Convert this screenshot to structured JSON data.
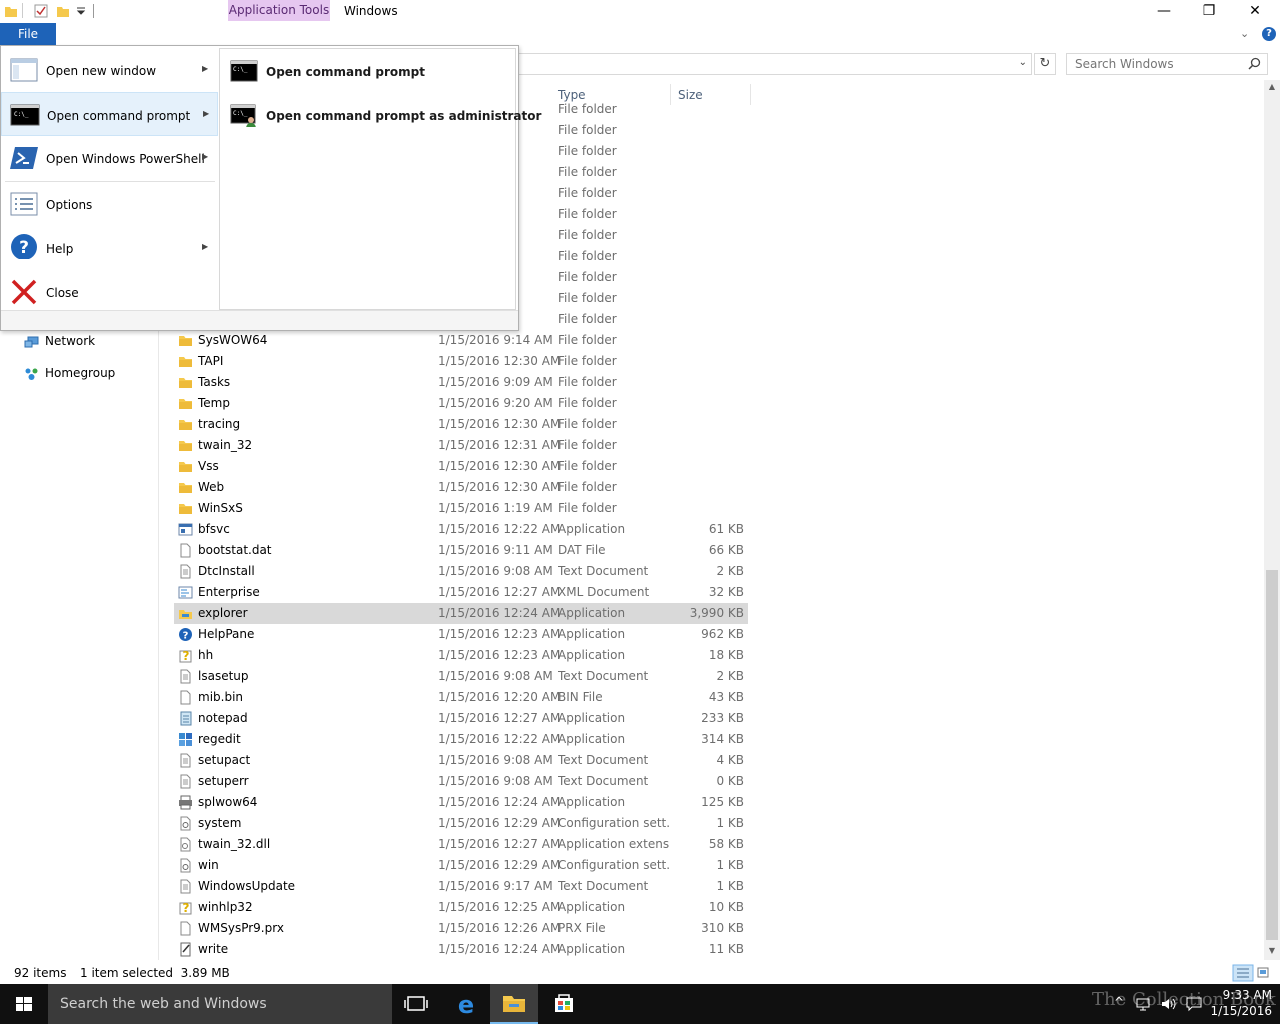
{
  "window": {
    "context_tab": "Application Tools",
    "title": "Windows",
    "min_glyph": "—",
    "max_glyph": "❐",
    "close_glyph": "✕"
  },
  "ribbon": {
    "file_tab": "File",
    "expand_glyph": "⌄",
    "help_glyph": "?"
  },
  "address": {
    "dropdown_glyph": "⌄",
    "refresh_glyph": "↻"
  },
  "search": {
    "placeholder": "Search Windows"
  },
  "nav": {
    "items": [
      {
        "label": "Network",
        "icon": "network-icon"
      },
      {
        "label": "Homegroup",
        "icon": "homegroup-icon"
      }
    ]
  },
  "columns": {
    "type": "Type",
    "size": "Size"
  },
  "files": [
    {
      "name": "",
      "date": "",
      "type": "File folder",
      "size": "",
      "icon": "folder"
    },
    {
      "name": "",
      "date": "AM",
      "type": "File folder",
      "size": "",
      "icon": "folder"
    },
    {
      "name": "",
      "date": "AM",
      "type": "File folder",
      "size": "",
      "icon": "folder"
    },
    {
      "name": "",
      "date": "AM",
      "type": "File folder",
      "size": "",
      "icon": "folder"
    },
    {
      "name": "",
      "date": "AM",
      "type": "File folder",
      "size": "",
      "icon": "folder"
    },
    {
      "name": "",
      "date": "AM",
      "type": "File folder",
      "size": "",
      "icon": "folder"
    },
    {
      "name": "",
      "date": "AM",
      "type": "File folder",
      "size": "",
      "icon": "folder"
    },
    {
      "name": "",
      "date": "AM",
      "type": "File folder",
      "size": "",
      "icon": "folder"
    },
    {
      "name": "",
      "date": "AM",
      "type": "File folder",
      "size": "",
      "icon": "folder"
    },
    {
      "name": "",
      "date": "AM",
      "type": "File folder",
      "size": "",
      "icon": "folder"
    },
    {
      "name": "",
      "date": "AM",
      "type": "File folder",
      "size": "",
      "icon": "folder"
    },
    {
      "name": "SysWOW64",
      "date": "1/15/2016 9:14 AM",
      "type": "File folder",
      "size": "",
      "icon": "folder"
    },
    {
      "name": "TAPI",
      "date": "1/15/2016 12:30 AM",
      "type": "File folder",
      "size": "",
      "icon": "folder"
    },
    {
      "name": "Tasks",
      "date": "1/15/2016 9:09 AM",
      "type": "File folder",
      "size": "",
      "icon": "folder"
    },
    {
      "name": "Temp",
      "date": "1/15/2016 9:20 AM",
      "type": "File folder",
      "size": "",
      "icon": "folder"
    },
    {
      "name": "tracing",
      "date": "1/15/2016 12:30 AM",
      "type": "File folder",
      "size": "",
      "icon": "folder"
    },
    {
      "name": "twain_32",
      "date": "1/15/2016 12:31 AM",
      "type": "File folder",
      "size": "",
      "icon": "folder"
    },
    {
      "name": "Vss",
      "date": "1/15/2016 12:30 AM",
      "type": "File folder",
      "size": "",
      "icon": "folder"
    },
    {
      "name": "Web",
      "date": "1/15/2016 12:30 AM",
      "type": "File folder",
      "size": "",
      "icon": "folder"
    },
    {
      "name": "WinSxS",
      "date": "1/15/2016 1:19 AM",
      "type": "File folder",
      "size": "",
      "icon": "folder"
    },
    {
      "name": "bfsvc",
      "date": "1/15/2016 12:22 AM",
      "type": "Application",
      "size": "61 KB",
      "icon": "app"
    },
    {
      "name": "bootstat.dat",
      "date": "1/15/2016 9:11 AM",
      "type": "DAT File",
      "size": "66 KB",
      "icon": "file"
    },
    {
      "name": "DtcInstall",
      "date": "1/15/2016 9:08 AM",
      "type": "Text Document",
      "size": "2 KB",
      "icon": "text"
    },
    {
      "name": "Enterprise",
      "date": "1/15/2016 12:27 AM",
      "type": "XML Document",
      "size": "32 KB",
      "icon": "xml"
    },
    {
      "name": "explorer",
      "date": "1/15/2016 12:24 AM",
      "type": "Application",
      "size": "3,990 KB",
      "icon": "explorer",
      "selected": true
    },
    {
      "name": "HelpPane",
      "date": "1/15/2016 12:23 AM",
      "type": "Application",
      "size": "962 KB",
      "icon": "help"
    },
    {
      "name": "hh",
      "date": "1/15/2016 12:23 AM",
      "type": "Application",
      "size": "18 KB",
      "icon": "hh"
    },
    {
      "name": "lsasetup",
      "date": "1/15/2016 9:08 AM",
      "type": "Text Document",
      "size": "2 KB",
      "icon": "text"
    },
    {
      "name": "mib.bin",
      "date": "1/15/2016 12:20 AM",
      "type": "BIN File",
      "size": "43 KB",
      "icon": "file"
    },
    {
      "name": "notepad",
      "date": "1/15/2016 12:27 AM",
      "type": "Application",
      "size": "233 KB",
      "icon": "notepad"
    },
    {
      "name": "regedit",
      "date": "1/15/2016 12:22 AM",
      "type": "Application",
      "size": "314 KB",
      "icon": "regedit"
    },
    {
      "name": "setupact",
      "date": "1/15/2016 9:08 AM",
      "type": "Text Document",
      "size": "4 KB",
      "icon": "text"
    },
    {
      "name": "setuperr",
      "date": "1/15/2016 9:08 AM",
      "type": "Text Document",
      "size": "0 KB",
      "icon": "text"
    },
    {
      "name": "splwow64",
      "date": "1/15/2016 12:24 AM",
      "type": "Application",
      "size": "125 KB",
      "icon": "printer"
    },
    {
      "name": "system",
      "date": "1/15/2016 12:29 AM",
      "type": "Configuration sett...",
      "size": "1 KB",
      "icon": "config"
    },
    {
      "name": "twain_32.dll",
      "date": "1/15/2016 12:27 AM",
      "type": "Application extens...",
      "size": "58 KB",
      "icon": "dll"
    },
    {
      "name": "win",
      "date": "1/15/2016 12:29 AM",
      "type": "Configuration sett...",
      "size": "1 KB",
      "icon": "config"
    },
    {
      "name": "WindowsUpdate",
      "date": "1/15/2016 9:17 AM",
      "type": "Text Document",
      "size": "1 KB",
      "icon": "text"
    },
    {
      "name": "winhlp32",
      "date": "1/15/2016 12:25 AM",
      "type": "Application",
      "size": "10 KB",
      "icon": "hh"
    },
    {
      "name": "WMSysPr9.prx",
      "date": "1/15/2016 12:26 AM",
      "type": "PRX File",
      "size": "310 KB",
      "icon": "file"
    },
    {
      "name": "write",
      "date": "1/15/2016 12:24 AM",
      "type": "Application",
      "size": "11 KB",
      "icon": "write"
    }
  ],
  "status": {
    "item_count": "92 items",
    "selection": "1 item selected  3.89 MB"
  },
  "file_menu": {
    "items": [
      {
        "label": "Open new window",
        "icon": "new-window-icon",
        "submenu": true
      },
      {
        "label": "Open command prompt",
        "icon": "command-prompt-icon",
        "submenu": true,
        "highlighted": true
      },
      {
        "label": "Open Windows PowerShell",
        "icon": "powershell-icon",
        "submenu": true
      },
      {
        "label": "Options",
        "icon": "options-icon",
        "submenu": false
      },
      {
        "label": "Help",
        "icon": "help-icon",
        "submenu": true
      },
      {
        "label": "Close",
        "icon": "close-x-icon",
        "submenu": false
      }
    ],
    "submenu": [
      {
        "label": "Open command prompt",
        "icon": "command-prompt-icon"
      },
      {
        "label": "Open command prompt as administrator",
        "icon": "admin-command-prompt-icon"
      }
    ],
    "arrow_glyph": "▶"
  },
  "taskbar": {
    "search_text": "Search the web and Windows",
    "watermark": "The Collection Book",
    "time": "9:33 AM",
    "date": "1/15/2016",
    "tray_up_glyph": "^"
  },
  "colors": {
    "file_tab": "#1e63b8",
    "context_tab": "#e6c7f0",
    "folder": "#f5c94d",
    "selection": "#d9d9d9",
    "taskbar": "#101010"
  }
}
